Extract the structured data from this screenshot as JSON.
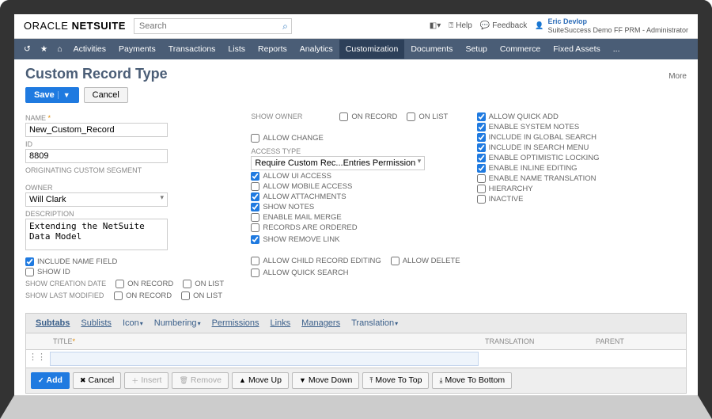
{
  "topbar": {
    "logo_brand": "ORACLE",
    "logo_product": "NETSUITE",
    "search_placeholder": "Search",
    "help": "Help",
    "feedback": "Feedback",
    "user_name": "Eric Devlop",
    "user_role": "SuiteSuccess Demo FF PRM - Administrator"
  },
  "nav": {
    "items": [
      "Activities",
      "Payments",
      "Transactions",
      "Lists",
      "Reports",
      "Analytics",
      "Customization",
      "Documents",
      "Setup",
      "Commerce",
      "Fixed Assets",
      "..."
    ],
    "active": "Customization"
  },
  "page": {
    "title": "Custom Record Type",
    "more": "More",
    "buttons": {
      "save": "Save",
      "cancel": "Cancel"
    }
  },
  "left": {
    "name_label": "NAME",
    "name_value": "New_Custom_Record",
    "id_label": "ID",
    "id_value": "8809",
    "seg_label": "ORIGINATING CUSTOM SEGMENT",
    "owner_label": "OWNER",
    "owner_value": "Will Clark",
    "desc_label": "DESCRIPTION",
    "desc_value": "Extending the NetSuite Data Model",
    "include_name": "INCLUDE NAME FIELD",
    "show_id": "SHOW ID",
    "show_creation": "SHOW CREATION DATE",
    "show_modified": "SHOW LAST MODIFIED",
    "on_record": "ON RECORD",
    "on_list": "ON LIST"
  },
  "middle": {
    "show_owner": "SHOW OWNER",
    "on_record": "ON RECORD",
    "on_list": "ON LIST",
    "allow_change": "ALLOW CHANGE",
    "access_type_label": "ACCESS TYPE",
    "access_type_value": "Require Custom Rec...Entries Permission",
    "allow_ui": "ALLOW UI ACCESS",
    "allow_mobile": "ALLOW MOBILE ACCESS",
    "allow_attach": "ALLOW ATTACHMENTS",
    "show_notes": "SHOW NOTES",
    "enable_mail": "ENABLE MAIL MERGE",
    "records_ordered": "RECORDS ARE ORDERED",
    "show_remove": "SHOW REMOVE LINK",
    "allow_child": "ALLOW CHILD RECORD EDITING",
    "allow_delete": "ALLOW DELETE",
    "allow_quicksearch": "ALLOW QUICK SEARCH"
  },
  "right": {
    "allow_quickadd": "ALLOW QUICK ADD",
    "enable_system_notes": "ENABLE SYSTEM NOTES",
    "include_global_search": "INCLUDE IN GLOBAL SEARCH",
    "include_search_menu": "INCLUDE IN SEARCH MENU",
    "enable_optimistic": "ENABLE OPTIMISTIC LOCKING",
    "enable_inline": "ENABLE INLINE EDITING",
    "enable_name_trans": "ENABLE NAME TRANSLATION",
    "hierarchy": "HIERARCHY",
    "inactive": "INACTIVE"
  },
  "tabs": {
    "items": [
      "Subtabs",
      "Sublists",
      "Icon",
      "Numbering",
      "Permissions",
      "Links",
      "Managers",
      "Translation"
    ],
    "active": "Subtabs",
    "headers": {
      "title": "TITLE",
      "translation": "TRANSLATION",
      "parent": "PARENT"
    },
    "btns": {
      "add": "Add",
      "cancel": "Cancel",
      "insert": "Insert",
      "remove": "Remove",
      "moveup": "Move Up",
      "movedown": "Move Down",
      "movetop": "Move To Top",
      "movebottom": "Move To Bottom"
    }
  }
}
